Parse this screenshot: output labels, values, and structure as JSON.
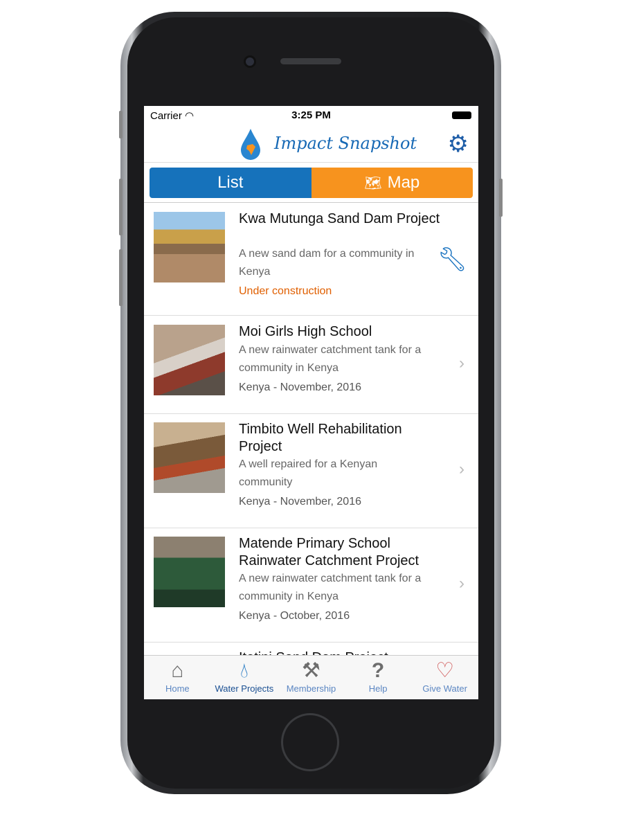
{
  "status": {
    "carrier": "Carrier",
    "time": "3:25 PM"
  },
  "header": {
    "title": "Impact Snapshot"
  },
  "segments": {
    "list": "List",
    "map": "Map"
  },
  "projects": [
    {
      "title": "Kwa Mutunga Sand Dam Project",
      "description": "A new sand dam for a community in Kenya",
      "meta": "Under construction",
      "action": "wrench-icon"
    },
    {
      "title": "Moi Girls High School",
      "description": "A new rainwater catchment tank for a community in Kenya",
      "meta": "Kenya - November, 2016",
      "action": "chevron-right-icon"
    },
    {
      "title": "Timbito Well Rehabilitation Project",
      "description": "A well repaired for a Kenyan community",
      "meta": "Kenya - November, 2016",
      "action": "chevron-right-icon"
    },
    {
      "title": "Matende Primary School Rainwater Catchment Project",
      "description": "A new rainwater catchment tank for a community in Kenya",
      "meta": "Kenya - October, 2016",
      "action": "chevron-right-icon"
    },
    {
      "title": "Itetini Sand Dam Project"
    }
  ],
  "tabs": [
    {
      "label": "Home",
      "icon": "home-icon"
    },
    {
      "label": "Water Projects",
      "icon": "water-drop-icon",
      "active": true
    },
    {
      "label": "Membership",
      "icon": "tools-icon"
    },
    {
      "label": "Help",
      "icon": "question-icon"
    },
    {
      "label": "Give Water",
      "icon": "heart-icon"
    }
  ],
  "colors": {
    "list": "#1672bb",
    "map": "#f7931e",
    "accent": "#1a73c0",
    "status_construction": "#e05f00"
  }
}
